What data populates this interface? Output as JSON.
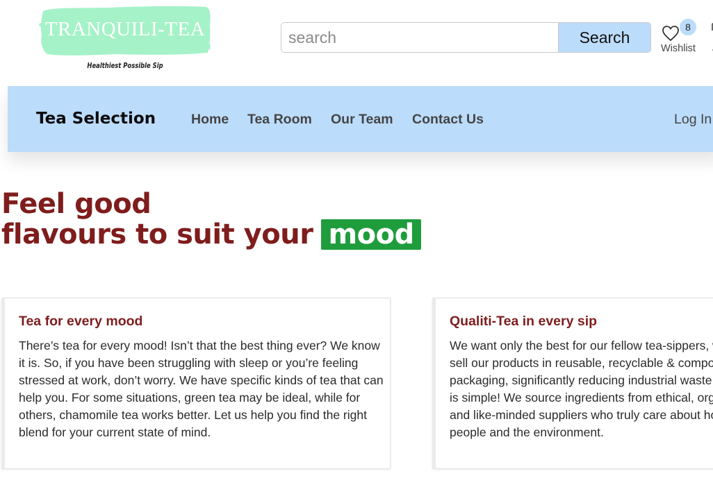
{
  "brand": {
    "logo_text": "TRANQUILI-TEA",
    "tagline": "Healthiest Possible Sip",
    "logo_color": "#a5f2c8"
  },
  "search": {
    "placeholder": "search",
    "button_label": "Search"
  },
  "wishlist": {
    "icon": "heart-icon",
    "count": "8",
    "label": "Wishlist"
  },
  "nav": {
    "brand": "Tea Selection",
    "links": [
      "Home",
      "Tea Room",
      "Our Team",
      "Contact Us"
    ],
    "login": "Log In",
    "background": "#bcdcfb"
  },
  "hero": {
    "line1": "Feel good",
    "line2": "flavours to suit your",
    "highlight": "mood",
    "text_color": "#7f1d1d",
    "highlight_color": "#1f9d3d"
  },
  "cards": [
    {
      "title": "Tea for every mood",
      "body": "There’s tea for every mood! Isn’t that the best thing ever? We know it is. So, if you have been struggling with sleep or you’re feeling stressed at work, don’t worry. We have specific kinds of tea that can help you. For some situations, green tea may be ideal, while for others, chamomile tea works better. Let us help you find the right blend for your current state of mind."
    },
    {
      "title": "Qualiti-Tea in every sip",
      "body_lines": [
        "We want only the best for our fellow tea-sippers, w",
        "sell our products in reusable, recyclable & compo",
        "packaging, significantly reducing industrial waste",
        "is simple! We source ingredients from ethical, org",
        "and like-minded suppliers who truly care about ho",
        "people and the environment."
      ]
    }
  ]
}
